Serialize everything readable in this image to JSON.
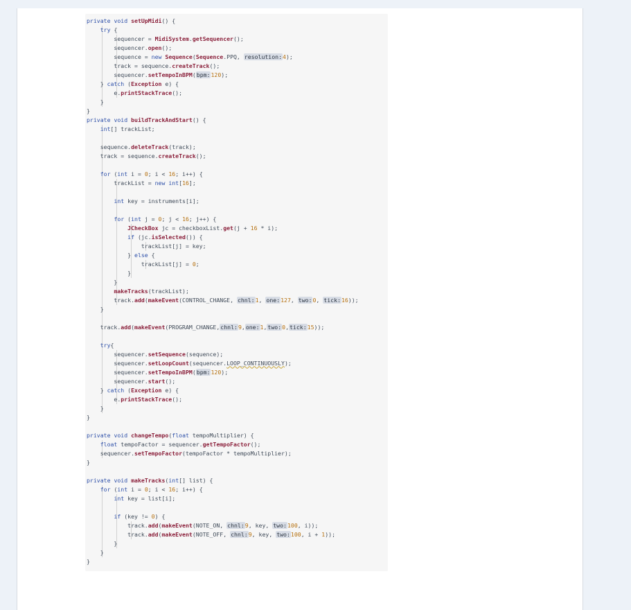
{
  "code": [
    "private void setUpMidi() {",
    "    try {",
    "        sequencer = MidiSystem.getSequencer();",
    "        sequencer.open();",
    "        sequence = new Sequence(Sequence.PPQ, resolution:4);",
    "        track = sequence.createTrack();",
    "        sequencer.setTempoInBPM(bpm:120);",
    "    } catch (Exception e) {",
    "        e.printStackTrace();",
    "    }",
    "}",
    "private void buildTrackAndStart() {",
    "    int[] trackList;",
    "",
    "    sequence.deleteTrack(track);",
    "    track = sequence.createTrack();",
    "",
    "    for (int i = 0; i < 16; i++) {",
    "        trackList = new int[16];",
    "",
    "        int key = instruments[i];",
    "",
    "        for (int j = 0; j < 16; j++) {",
    "            JCheckBox jc = checkboxList.get(j + 16 * i);",
    "            if (jc.isSelected()) {",
    "                trackList[j] = key;",
    "            } else {",
    "                trackList[j] = 0;",
    "            }",
    "        }",
    "        makeTracks(trackList);",
    "        track.add(makeEvent(CONTROL_CHANGE, chnl:1, one:127, two:0, tick:16));",
    "    }",
    "",
    "    track.add(makeEvent(PROGRAM_CHANGE,chnl:9,one:1,two:0,tick:15));",
    "",
    "    try{",
    "        sequencer.setSequence(sequence);",
    "        sequencer.setLoopCount(sequencer.LOOP_CONTINUOUSLY);",
    "        sequencer.setTempoInBPM(bpm:120);",
    "        sequencer.start();",
    "    } catch (Exception e) {",
    "        e.printStackTrace();",
    "    }",
    "}",
    "",
    "private void changeTempo(float tempoMultiplier) {",
    "    float tempoFactor = sequencer.getTempoFactor();",
    "    sequencer.setTempoFactor(tempoFactor * tempoMultiplier);",
    "}",
    "",
    "private void makeTracks(int[] list) {",
    "    for (int i = 0; i < 16; i++) {",
    "        int key = list[i];",
    "",
    "        if (key != 0) {",
    "            track.add(makeEvent(NOTE_ON, chnl:9, key, two:100, i));",
    "            track.add(makeEvent(NOTE_OFF, chnl:9, key, two:100, i + 1));",
    "        }",
    "    }",
    "}"
  ]
}
